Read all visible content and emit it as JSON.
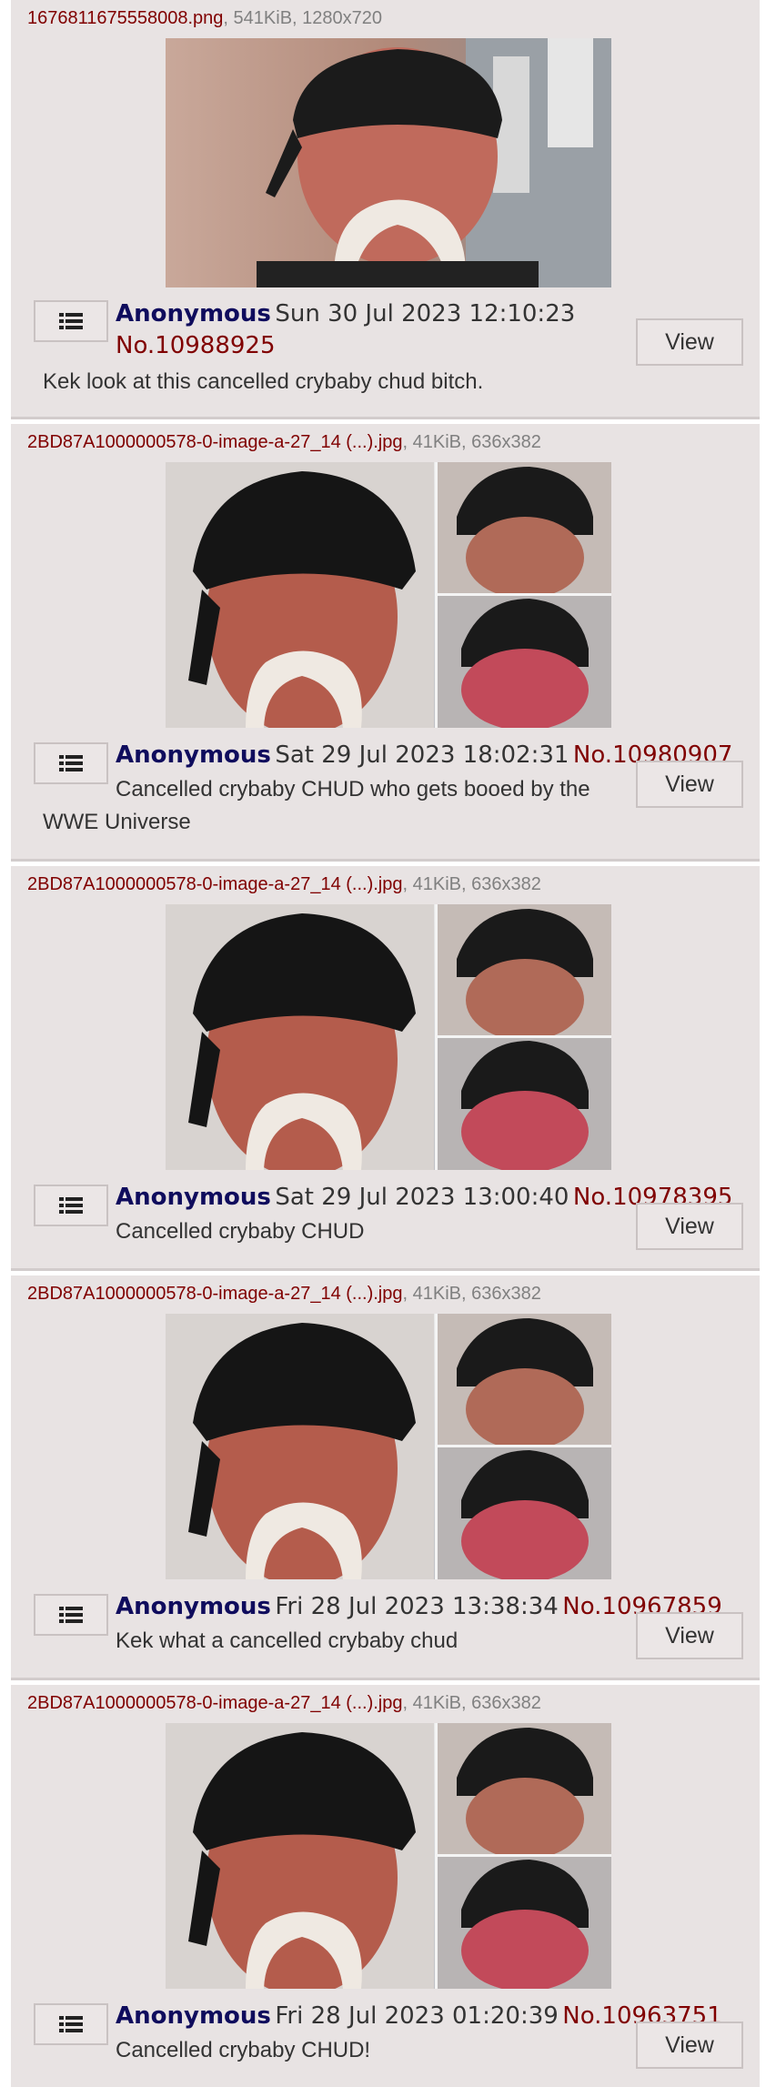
{
  "posts": [
    {
      "filename": "1676811675558008.png",
      "filemeta": ", 541KiB, 1280x720",
      "name": "Anonymous",
      "date": "Sun 30 Jul 2023 12:10:23",
      "postno": "No.10988925",
      "comment": "Kek look at this cancelled crybaby chud bitch.",
      "view_label": "View"
    },
    {
      "filename": "2BD87A1000000578-0-image-a-27_14 (...).jpg",
      "filemeta": ", 41KiB, 636x382",
      "name": "Anonymous",
      "date": "Sat 29 Jul 2023 18:02:31",
      "postno": "No.10980907",
      "comment_line1": "Cancelled crybaby CHUD who gets booed by the",
      "comment_line2": "WWE Universe",
      "view_label": "View"
    },
    {
      "filename": "2BD87A1000000578-0-image-a-27_14 (...).jpg",
      "filemeta": ", 41KiB, 636x382",
      "name": "Anonymous",
      "date": "Sat 29 Jul 2023 13:00:40",
      "postno": "No.10978395",
      "comment": "Cancelled crybaby CHUD",
      "view_label": "View"
    },
    {
      "filename": "2BD87A1000000578-0-image-a-27_14 (...).jpg",
      "filemeta": ", 41KiB, 636x382",
      "name": "Anonymous",
      "date": "Fri 28 Jul 2023 13:38:34",
      "postno": "No.10967859",
      "comment": "Kek what a cancelled crybaby chud",
      "view_label": "View"
    },
    {
      "filename": "2BD87A1000000578-0-image-a-27_14 (...).jpg",
      "filemeta": ", 41KiB, 636x382",
      "name": "Anonymous",
      "date": "Fri 28 Jul 2023 01:20:39",
      "postno": "No.10963751",
      "comment": "Cancelled crybaby CHUD!",
      "view_label": "View"
    }
  ],
  "icons": {
    "post_menu": "menu-list-icon"
  }
}
